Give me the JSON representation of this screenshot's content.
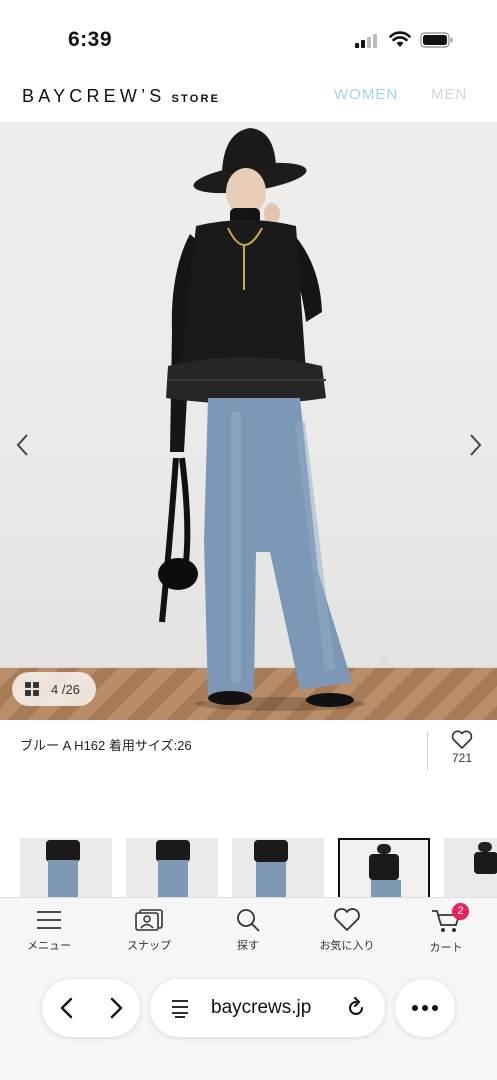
{
  "status_bar": {
    "time": "6:39"
  },
  "header": {
    "logo_main": "BAYCREW’S",
    "logo_sub": "STORE",
    "nav_women": "WOMEN",
    "nav_men": "MEN",
    "nav_women_color": "#9fd4ec",
    "nav_men_color": "#d4d4d4"
  },
  "gallery": {
    "counter": "4 /26",
    "prev_icon": "chevron-left-icon",
    "next_icon": "chevron-right-icon"
  },
  "caption": {
    "text": "ブルー A H162 着用サイズ:26",
    "favorite_count": "721",
    "favorite_icon": "heart-icon"
  },
  "thumbnails": {
    "active_index": 3
  },
  "tabbar": {
    "items": [
      {
        "label": "メニュー",
        "icon": "menu-icon"
      },
      {
        "label": "スナップ",
        "icon": "snap-icon"
      },
      {
        "label": "探す",
        "icon": "search-icon"
      },
      {
        "label": "お気に入り",
        "icon": "heart-icon"
      },
      {
        "label": "カート",
        "icon": "cart-icon"
      }
    ],
    "cart_badge": "2",
    "badge_color": "#e5245c"
  },
  "browser": {
    "url": "baycrews.jp"
  }
}
